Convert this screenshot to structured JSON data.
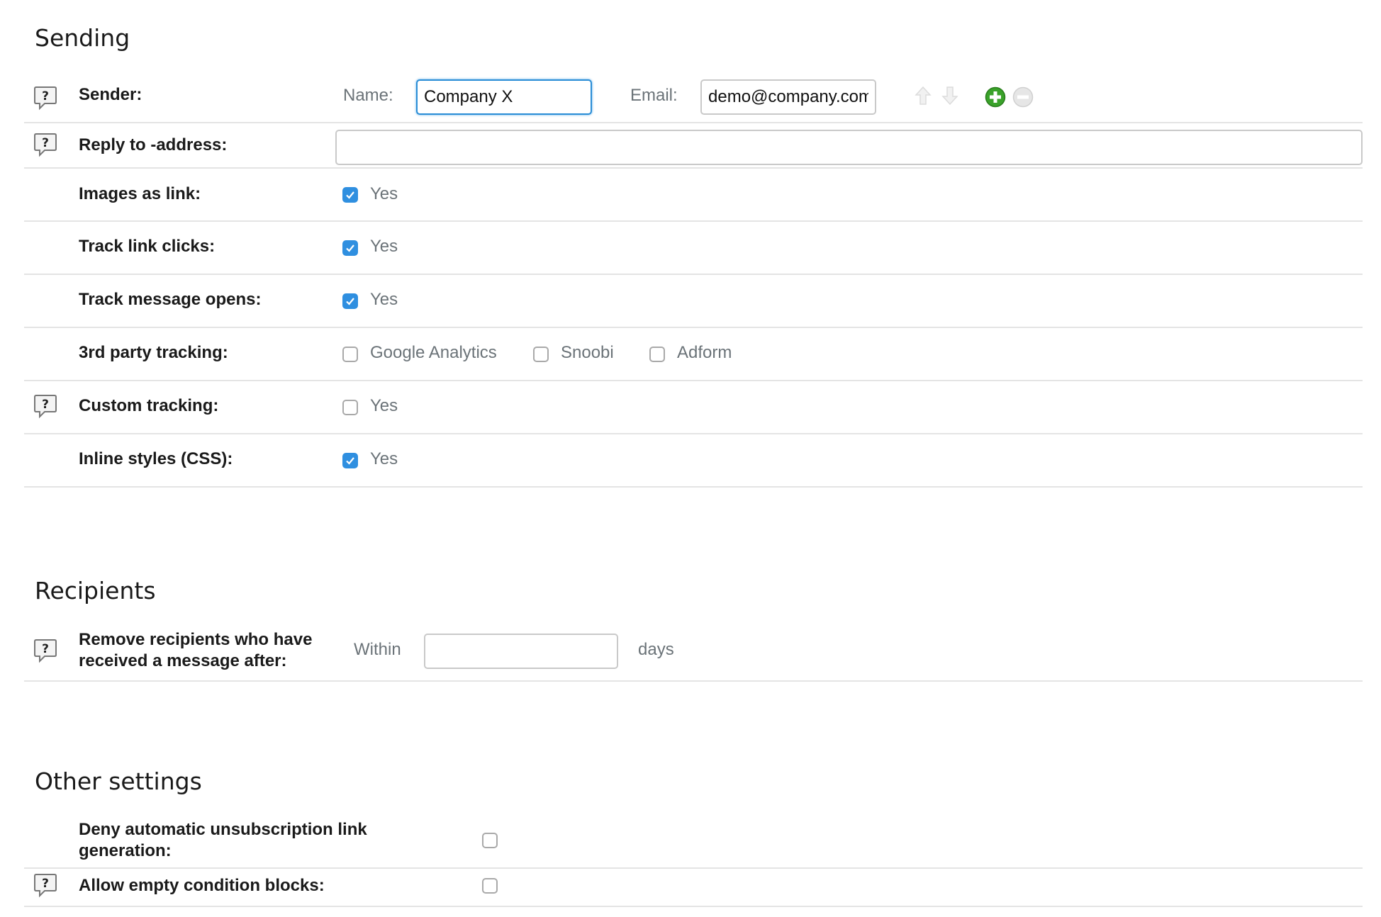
{
  "sections": {
    "sending": "Sending",
    "recipients": "Recipients",
    "other": "Other settings"
  },
  "sender": {
    "label": "Sender:",
    "name_label": "Name:",
    "name_value": "Company X",
    "email_label": "Email:",
    "email_value": "demo@company.com",
    "icons": [
      "arrow-up-icon",
      "arrow-down-icon",
      "add-icon",
      "remove-icon"
    ]
  },
  "reply_to": {
    "label": "Reply to -address:",
    "value": ""
  },
  "images_as_link": {
    "label": "Images as link:",
    "option": "Yes",
    "checked": true
  },
  "track_link_clicks": {
    "label": "Track link clicks:",
    "option": "Yes",
    "checked": true
  },
  "track_message_opens": {
    "label": "Track message opens:",
    "option": "Yes",
    "checked": true
  },
  "third_party": {
    "label": "3rd party tracking:",
    "options": [
      {
        "label": "Google Analytics",
        "checked": false
      },
      {
        "label": "Snoobi",
        "checked": false
      },
      {
        "label": "Adform",
        "checked": false
      }
    ]
  },
  "custom_tracking": {
    "label": "Custom tracking:",
    "option": "Yes",
    "checked": false
  },
  "inline_styles": {
    "label": "Inline styles (CSS):",
    "option": "Yes",
    "checked": true
  },
  "remove_recipients": {
    "label_line1": "Remove recipients who have",
    "label_line2": "received a message after:",
    "prefix": "Within",
    "value": "",
    "suffix": "days"
  },
  "deny_unsubscription": {
    "label_line1": "Deny automatic unsubscription link",
    "label_line2": "generation:",
    "checked": false
  },
  "allow_empty_blocks": {
    "label": "Allow empty condition blocks:",
    "checked": false
  },
  "colors": {
    "accent": "#2f8fe0",
    "focus_border": "#2a8dd6",
    "add_green": "#3aa22a",
    "divider": "#e4e4e4"
  }
}
